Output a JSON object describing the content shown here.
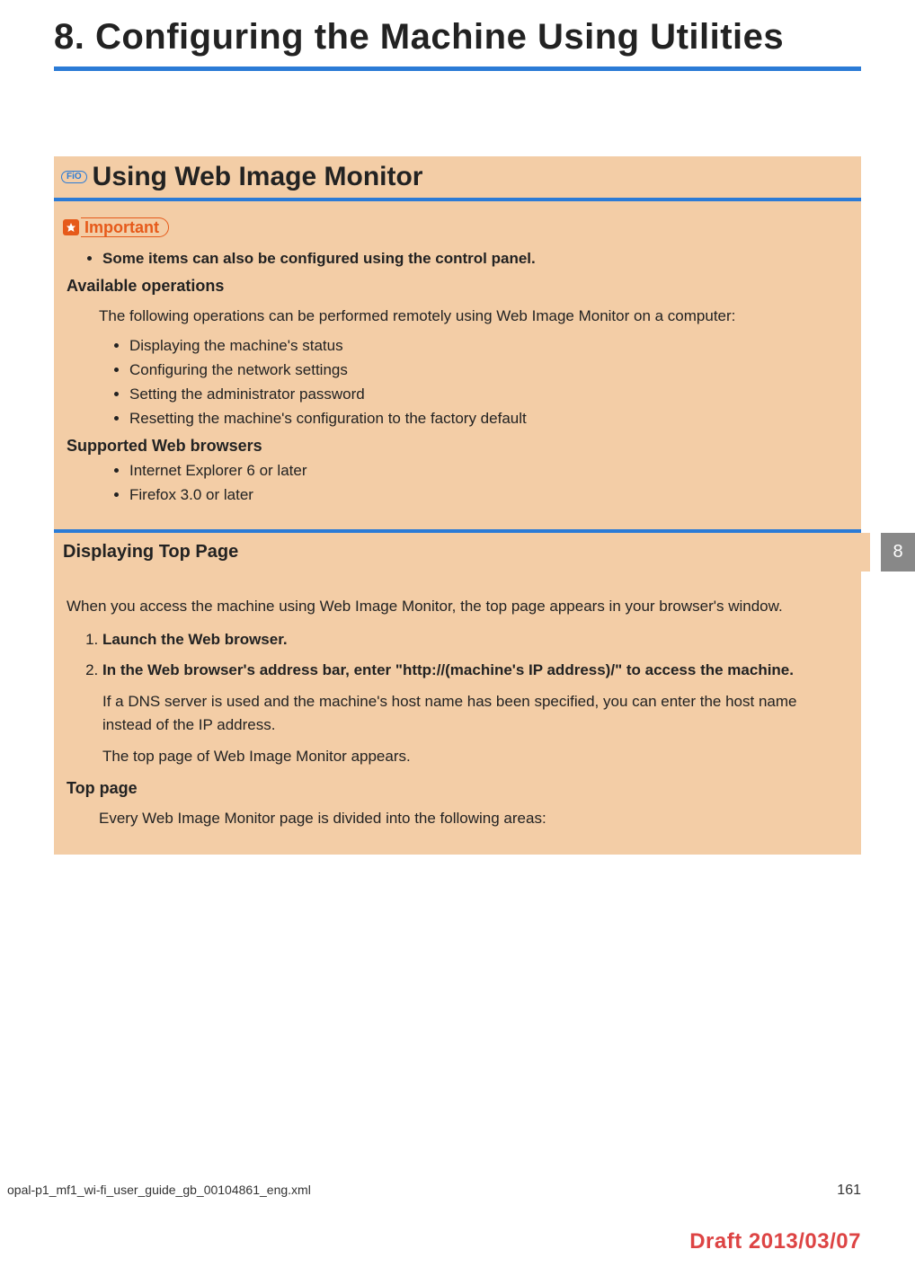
{
  "chapter": {
    "title": "8. Configuring the Machine Using Utilities"
  },
  "section": {
    "badge": "FiO",
    "heading": "Using Web Image Monitor"
  },
  "important": {
    "label": "Important",
    "items": [
      "Some items can also be configured using the control panel."
    ]
  },
  "available_ops": {
    "heading": "Available operations",
    "intro": "The following operations can be performed remotely using Web Image Monitor on a computer:",
    "items": [
      "Displaying the machine's status",
      "Configuring the network settings",
      "Setting the administrator password",
      "Resetting the machine's configuration to the factory default"
    ]
  },
  "browsers": {
    "heading": "Supported Web browsers",
    "items": [
      "Internet Explorer 6 or later",
      "Firefox 3.0 or later"
    ]
  },
  "subsection": {
    "heading": "Displaying Top Page",
    "tab": "8",
    "intro": "When you access the machine using Web Image Monitor, the top page appears in your browser's window.",
    "steps": [
      {
        "title": "Launch the Web browser.",
        "body1": "",
        "body2": ""
      },
      {
        "title": "In the Web browser's address bar, enter \"http://(machine's IP address)/\" to access the machine.",
        "body1": "If a DNS server is used and the machine's host name has been specified, you can enter the host name instead of the IP address.",
        "body2": "The top page of Web Image Monitor appears."
      }
    ],
    "top_page_heading": "Top page",
    "top_page_text": "Every Web Image Monitor page is divided into the following areas:"
  },
  "footer": {
    "left": "opal-p1_mf1_wi-fi_user_guide_gb_00104861_eng.xml",
    "right": "161"
  },
  "draft": "Draft 2013/03/07"
}
